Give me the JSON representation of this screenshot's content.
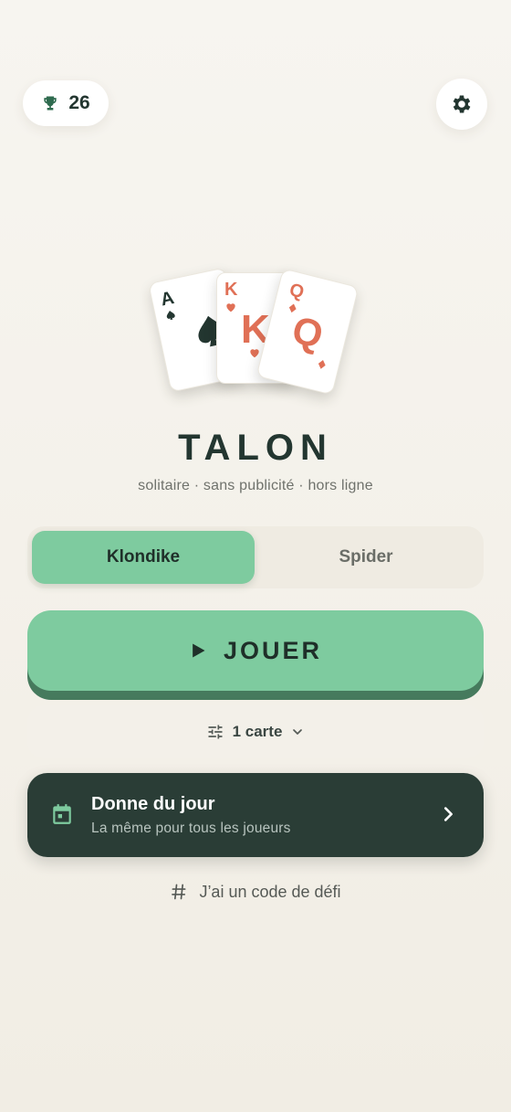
{
  "header": {
    "trophy_count": "26",
    "trophy_icon": "trophy-icon",
    "settings_icon": "gear-icon"
  },
  "cards": {
    "ace": {
      "rank": "A",
      "suit": "spade"
    },
    "king": {
      "rank": "K",
      "suit": "heart"
    },
    "queen": {
      "rank": "Q",
      "suit": "diamond"
    }
  },
  "title": "TALON",
  "tagline": "solitaire · sans publicité · hors ligne",
  "modes": {
    "selected": "Klondike",
    "options": [
      "Klondike",
      "Spider"
    ]
  },
  "play": {
    "label": "JOUER",
    "icon": "play-icon"
  },
  "draw": {
    "label": "1 carte",
    "icon": "tune-icon"
  },
  "daily": {
    "title": "Donne du jour",
    "subtitle": "La même pour tous les joueurs",
    "icon": "calendar-icon"
  },
  "challenge": {
    "label": "J’ai un code de défi",
    "icon": "hash-icon"
  },
  "colors": {
    "background": "#f4f1ea",
    "accent_green": "#7ecb9f",
    "accent_green_dark": "#467a5d",
    "dark_panel": "#2a3d36",
    "text_dark": "#233630",
    "card_red": "#e07056"
  }
}
